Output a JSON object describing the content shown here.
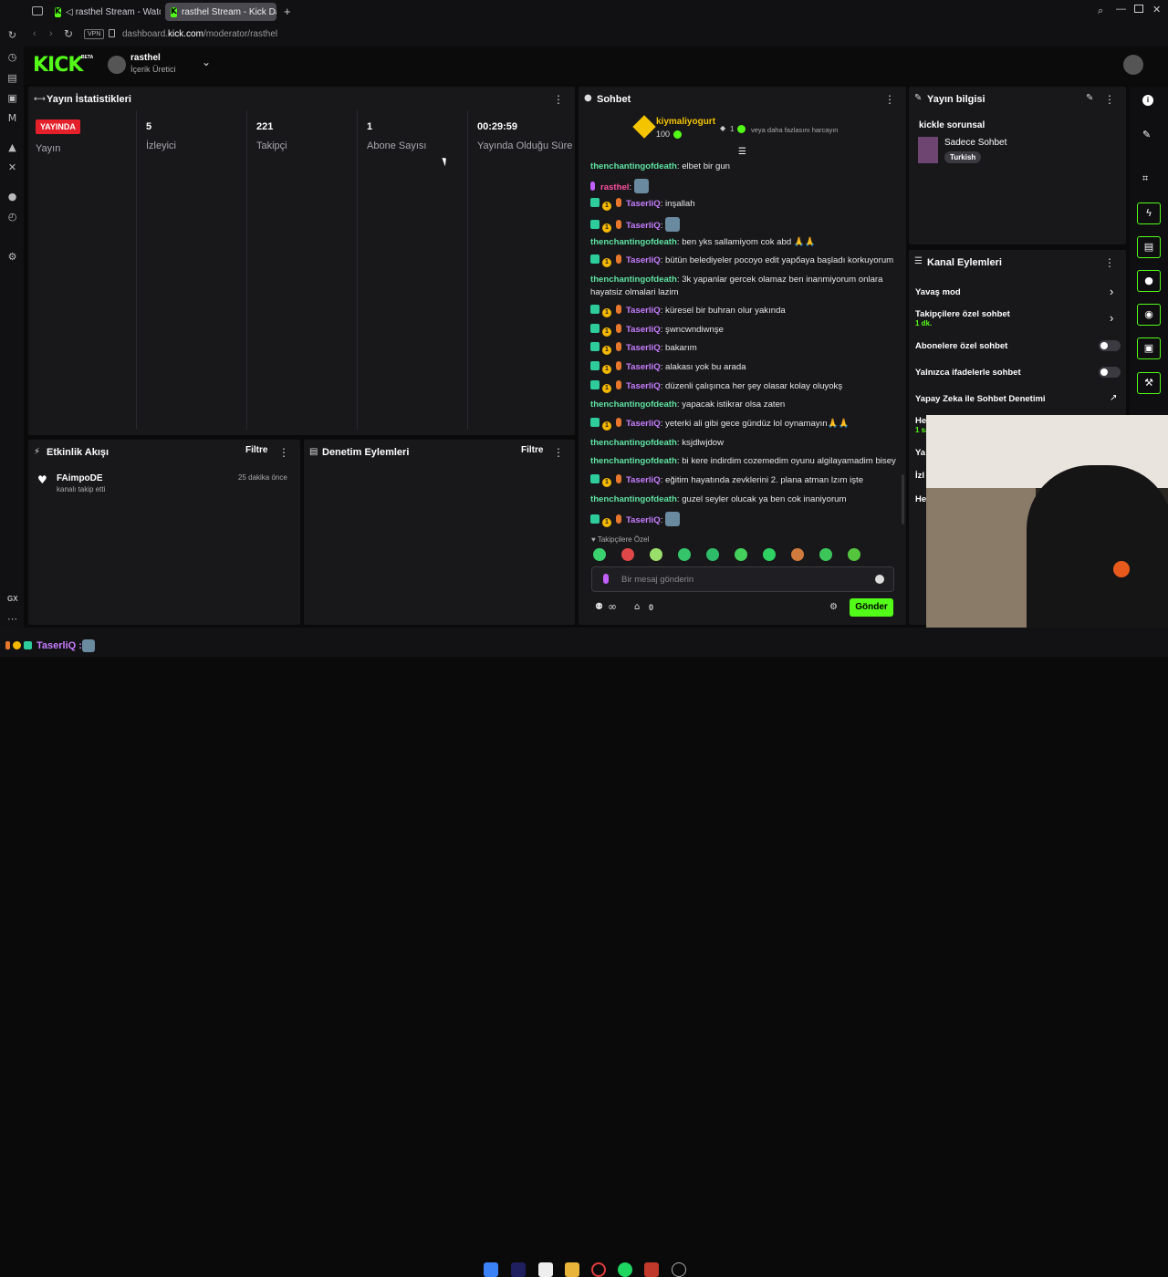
{
  "browser": {
    "tabs": [
      {
        "label": "rasthel Stream - Watc"
      },
      {
        "label": "rasthel Stream - Kick Das"
      }
    ],
    "vpn_badge": "VPN",
    "url_domain": "dashboard.",
    "url_host": "kick.com",
    "url_path": "/moderator/rasthel",
    "rail_label": "GX"
  },
  "header": {
    "logo": "KICK",
    "logo_sup": "BETA",
    "channel_name": "rasthel",
    "channel_role": "İçerik Üretici"
  },
  "stats_panel": {
    "title": "Yayın İstatistikleri",
    "live_badge": "YAYINDA",
    "live_label": "Yayın",
    "stats": [
      {
        "value": "5",
        "label": "İzleyici"
      },
      {
        "value": "221",
        "label": "Takipçi"
      },
      {
        "value": "1",
        "label": "Abone Sayısı"
      },
      {
        "value": "00:29:59",
        "label": "Yayında Olduğu Süre"
      }
    ]
  },
  "activity_panel": {
    "title": "Etkinlik Akışı",
    "filter": "Filtre",
    "items": [
      {
        "user": "FAimpoDE",
        "action": "kanalı takip etti",
        "time": "25 dakika önce"
      }
    ]
  },
  "mod_panel": {
    "title": "Denetim Eylemleri",
    "filter": "Filtre"
  },
  "chat": {
    "title": "Sohbet",
    "pinned_user": "kiymaliyogurt",
    "pinned_amount": "100",
    "pinned_count": "1",
    "pinned_note": "veya daha fazlasını harcayın",
    "messages": [
      {
        "user": "thenchantingofdeath",
        "text": "elbet bir gun",
        "style": "g",
        "badges": false
      },
      {
        "user": "rasthel",
        "text": "",
        "style": "r",
        "badges": false,
        "emote": true
      },
      {
        "user": "TaserliQ",
        "text": "inşallah",
        "style": "p",
        "badges": true
      },
      {
        "user": "TaserliQ",
        "text": "",
        "style": "p",
        "badges": true,
        "emote": true
      },
      {
        "user": "thenchantingofdeath",
        "text": "ben yks sallamiyom cok abd 🙏🙏",
        "style": "g",
        "badges": false
      },
      {
        "user": "TaserliQ",
        "text": "bütün belediyeler pocoyo edit yapőaya başladı korkuyorum",
        "style": "p",
        "badges": true
      },
      {
        "user": "thenchantingofdeath",
        "text": "3k yapanlar gercek olamaz ben inanmiyorum onlara hayatsiz olmalari lazim",
        "style": "g",
        "badges": false
      },
      {
        "user": "TaserliQ",
        "text": "küresel bir buhran olur yakında",
        "style": "p",
        "badges": true
      },
      {
        "user": "TaserliQ",
        "text": "şwncwndiwnşe",
        "style": "p",
        "badges": true
      },
      {
        "user": "TaserliQ",
        "text": "bakarım",
        "style": "p",
        "badges": true
      },
      {
        "user": "TaserliQ",
        "text": "alakası yok bu arada",
        "style": "p",
        "badges": true
      },
      {
        "user": "TaserliQ",
        "text": "düzenli çalışınca her şey olasar kolay oluyokş",
        "style": "p",
        "badges": true
      },
      {
        "user": "thenchantingofdeath",
        "text": "yapacak istikrar olsa zaten",
        "style": "g",
        "badges": false
      },
      {
        "user": "TaserliQ",
        "text": "yeterki ali gibi gece gündüz lol oynamayın🙏🙏",
        "style": "p",
        "badges": true
      },
      {
        "user": "thenchantingofdeath",
        "text": "ksjdlwjdow",
        "style": "g",
        "badges": false
      },
      {
        "user": "thenchantingofdeath",
        "text": "bi kere indirdim cozemedim oyunu algilayamadim bisey",
        "style": "g",
        "badges": false
      },
      {
        "user": "TaserliQ",
        "text": "eğitim hayatında zevklerini 2. plana atman lzım işte",
        "style": "p",
        "badges": true
      },
      {
        "user": "thenchantingofdeath",
        "text": "guzel seyler olucak ya ben cok inaniyorum",
        "style": "g",
        "badges": false
      },
      {
        "user": "TaserliQ",
        "text": "",
        "style": "p",
        "badges": true,
        "emote": true
      }
    ],
    "followers_only": "Takipçilere Özel",
    "placeholder": "Bir mesaj gönderin",
    "infinity": "∞",
    "viewer_count": "0",
    "send": "Gönder"
  },
  "stream_info": {
    "title": "Yayın bilgisi",
    "stream_title": "kickle sorunsal",
    "category": "Sadece Sohbet",
    "language": "Turkish"
  },
  "channel_actions": {
    "title": "Kanal Eylemleri",
    "items": [
      {
        "label": "Yavaş mod"
      },
      {
        "label": "Takipçilere özel sohbet",
        "sub": "1 dk."
      },
      {
        "label": "Abonelere özel sohbet"
      },
      {
        "label": "Yalnızca ifadelerle sohbet"
      },
      {
        "label": "Yapay Zeka ile Sohbet Denetimi"
      }
    ],
    "clipped": [
      "He",
      "1 sa",
      "Ya",
      "İzl",
      "He"
    ]
  },
  "overlay": {
    "user": "TaserliQ"
  },
  "colors": {
    "kick_green": "#53fc18",
    "live_red": "#e4212b",
    "panel": "#18181b"
  }
}
